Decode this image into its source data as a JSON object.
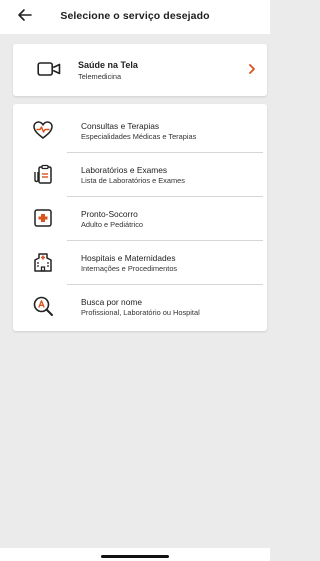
{
  "header": {
    "title": "Selecione o serviço desejado",
    "back_icon": "back-arrow-icon"
  },
  "telemedicine": {
    "label": "Saúde na Tela",
    "sub": "Telemedicina",
    "icon": "video-camera-icon",
    "chevron_icon": "chevron-right-icon",
    "accent": "#d9531e"
  },
  "services": [
    {
      "label": "Consultas e Terapias",
      "sub": "Especialidades Médicas e Terapias",
      "icon": "heart-pulse-icon"
    },
    {
      "label": "Laboratórios e Exames",
      "sub": "Lista de Laboratórios e Exames",
      "icon": "lab-clipboard-icon"
    },
    {
      "label": "Pronto-Socorro",
      "sub": "Adulto e Pediátrico",
      "icon": "first-aid-icon"
    },
    {
      "label": "Hospitais e Maternidades",
      "sub": "Internações e Procedimentos",
      "icon": "hospital-icon"
    },
    {
      "label": "Busca por nome",
      "sub": "Profissional, Laboratório ou Hospital",
      "icon": "search-name-icon"
    }
  ],
  "colors": {
    "background": "#ebebeb",
    "accent_red": "#d9531e"
  }
}
